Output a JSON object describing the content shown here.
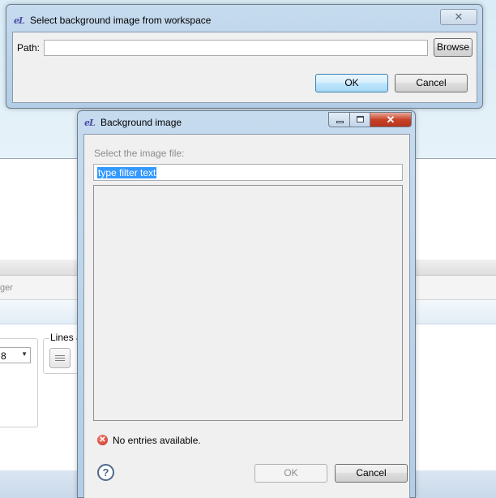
{
  "background_editor": {
    "partial_label": "ger",
    "combo_value": "8",
    "lines_group_label": "Lines a"
  },
  "select_image_dialog": {
    "title": "Select background image from workspace",
    "icon": "eclipse-app-icon",
    "close_glyph": "✕",
    "path_label": "Path:",
    "path_value": "",
    "browse_label": "Browse",
    "ok_label": "OK",
    "cancel_label": "Cancel"
  },
  "background_image_dialog": {
    "title": "Background image",
    "icon": "eclipse-app-icon",
    "select_label": "Select the image file:",
    "filter_text": "type filter text",
    "status_icon": "error-icon",
    "status_text": "No entries available.",
    "help_glyph": "?",
    "ok_label": "OK",
    "cancel_label": "Cancel",
    "close_glyph": "✕"
  },
  "colors": {
    "selection": "#3399ff",
    "error": "#c8281d",
    "close_button": "#c7432a"
  }
}
